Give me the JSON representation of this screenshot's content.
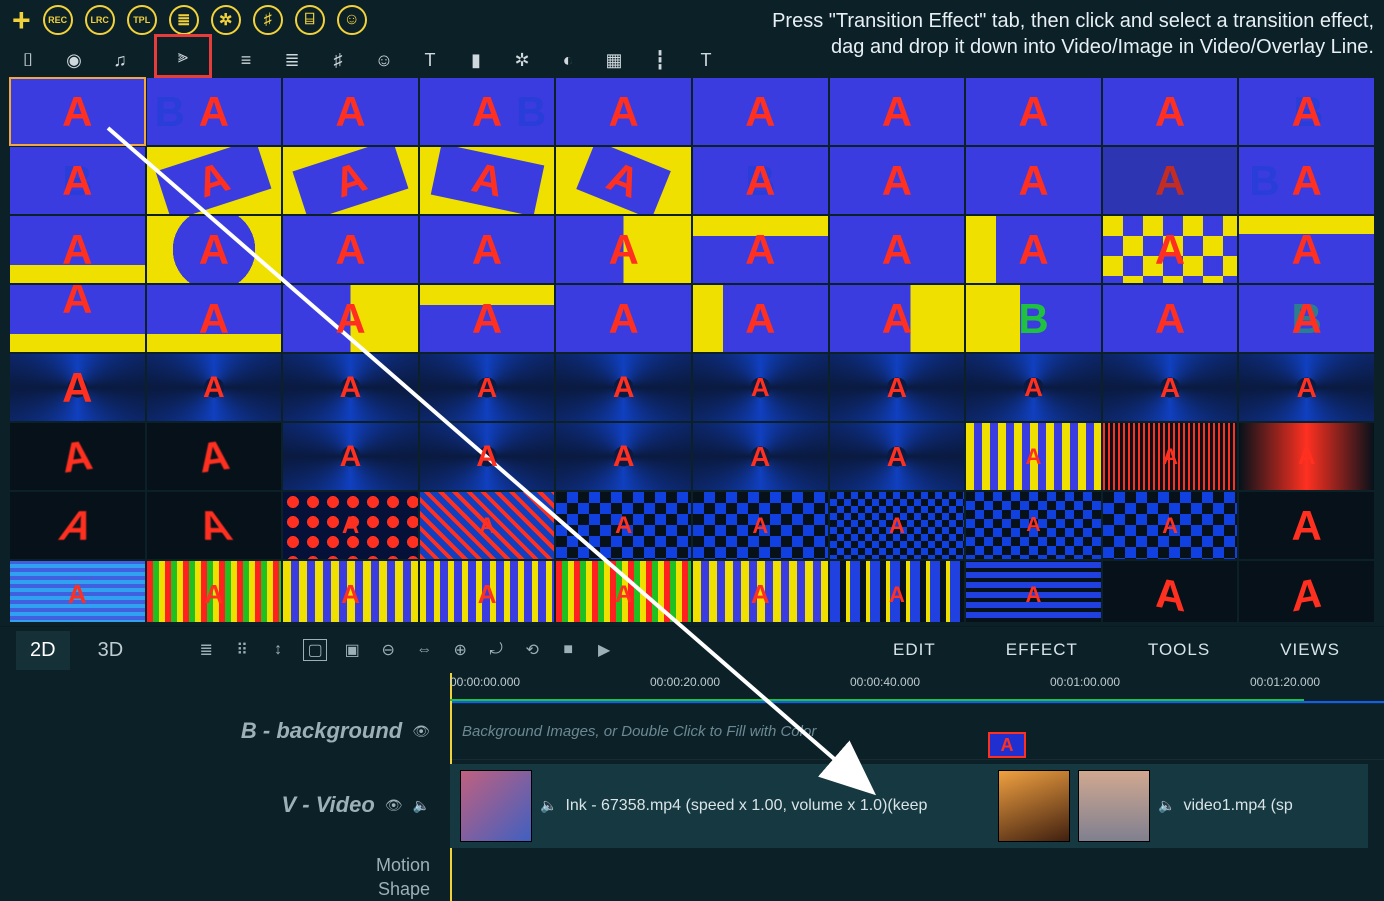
{
  "topButtons": [
    "REC",
    "LRC",
    "TPL",
    "≣",
    "✲",
    "♯",
    "⌸",
    "☺"
  ],
  "secondIcons": [
    "⌷",
    "◉",
    "♫",
    "⫸",
    "≡",
    "≣",
    "♯",
    "☺",
    "T",
    "▮",
    "✲",
    "◐",
    "▦",
    "┇",
    "T"
  ],
  "hintLine1": "Press \"Transition Effect\" tab, then click and select a transition effect,",
  "hintLine2": "dag and drop it down into Video/Image in Video/Overlay Line.",
  "tabs": {
    "d2": "2D",
    "d3": "3D"
  },
  "menus": [
    "EDIT",
    "EFFECT",
    "TOOLS",
    "VIEWS"
  ],
  "tlIcons": [
    "≣",
    "⠿",
    "↕",
    "▢",
    "▣",
    "⊖",
    "⇔",
    "⊕",
    "⤾",
    "⟲",
    "■",
    "▶"
  ],
  "ruler": [
    "00:00:00.000",
    "00:00:20.000",
    "00:00:40.000",
    "00:01:00.000",
    "00:01:20.000"
  ],
  "tracks": {
    "bg": "B - background",
    "video": "V - Video",
    "motion": "Motion",
    "shape": "Shape",
    "bgPlaceholder": "Background Images, or Double Click to Fill with Color"
  },
  "clips": {
    "c1": "Ink - 67358.mp4  (speed x 1.00, volume x 1.0)(keep",
    "c2": "video1.mp4  (sp"
  },
  "tileLetter": "A"
}
